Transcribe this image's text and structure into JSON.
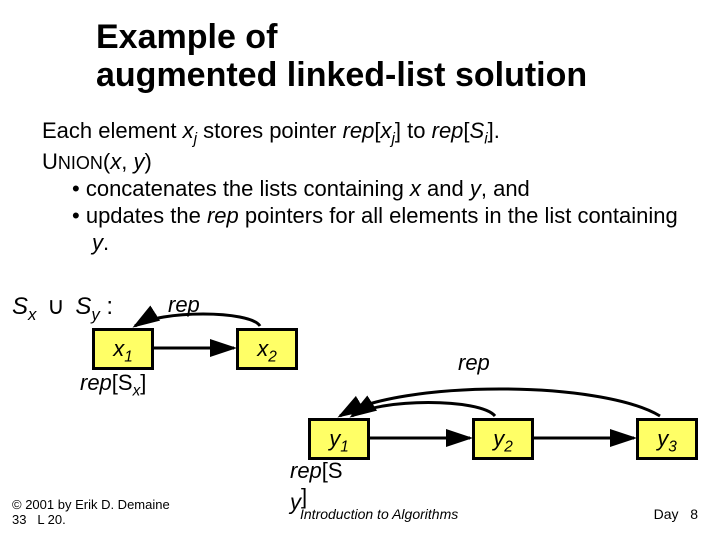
{
  "title": {
    "line1": "Example of",
    "line2": "augmented linked-list solution"
  },
  "body": {
    "each": "Each element ",
    "xj": "x",
    "xj_sub": "j",
    "stores": " stores pointer ",
    "rep": "rep",
    "bracket_xj_open": "[",
    "bracket_xj_close": "]",
    "to": " to ",
    "bracket_Si_open": "[",
    "Si": "S",
    "Si_sub": "i",
    "bracket_Si_close": "].",
    "union_pre": "U",
    "union_post": "NION",
    "openparen": "(",
    "x": "x",
    "comma": ", ",
    "y": "y",
    "closeparen": ")",
    "bullet1_a": "concatenates the lists containing ",
    "bullet1_b": " and ",
    "bullet1_c": ", and",
    "bullet2_a": "updates the ",
    "bullet2_b": " pointers for all elements in the list containing ",
    "bullet2_c": "."
  },
  "labels": {
    "Sx": "S",
    "Sx_sub": "x",
    "cup": "∪",
    "Sy": "S",
    "Sy_sub": "y",
    "colon": " :",
    "rep": "rep",
    "repSx_a": "rep",
    "repSx_b": "[S",
    "repSx_sub": "x",
    "repSx_c": "]",
    "repSy_a": "rep",
    "repSy_b": "[S",
    "repSy_bot": "y",
    "repSy_c": "]"
  },
  "nodes": {
    "x1": "x",
    "x1_sub": "1",
    "x2": "x",
    "x2_sub": "2",
    "y1": "y",
    "y1_sub": "1",
    "y2": "y",
    "y2_sub": "2",
    "y3": "y",
    "y3_sub": "3"
  },
  "footer": {
    "left_line1": "© 2001 by Erik D. Demaine",
    "left_line2a": "33",
    "left_line2b": "L 20.",
    "mid": "Introduction to Algorithms",
    "right_a": "Day",
    "right_b": "8"
  }
}
